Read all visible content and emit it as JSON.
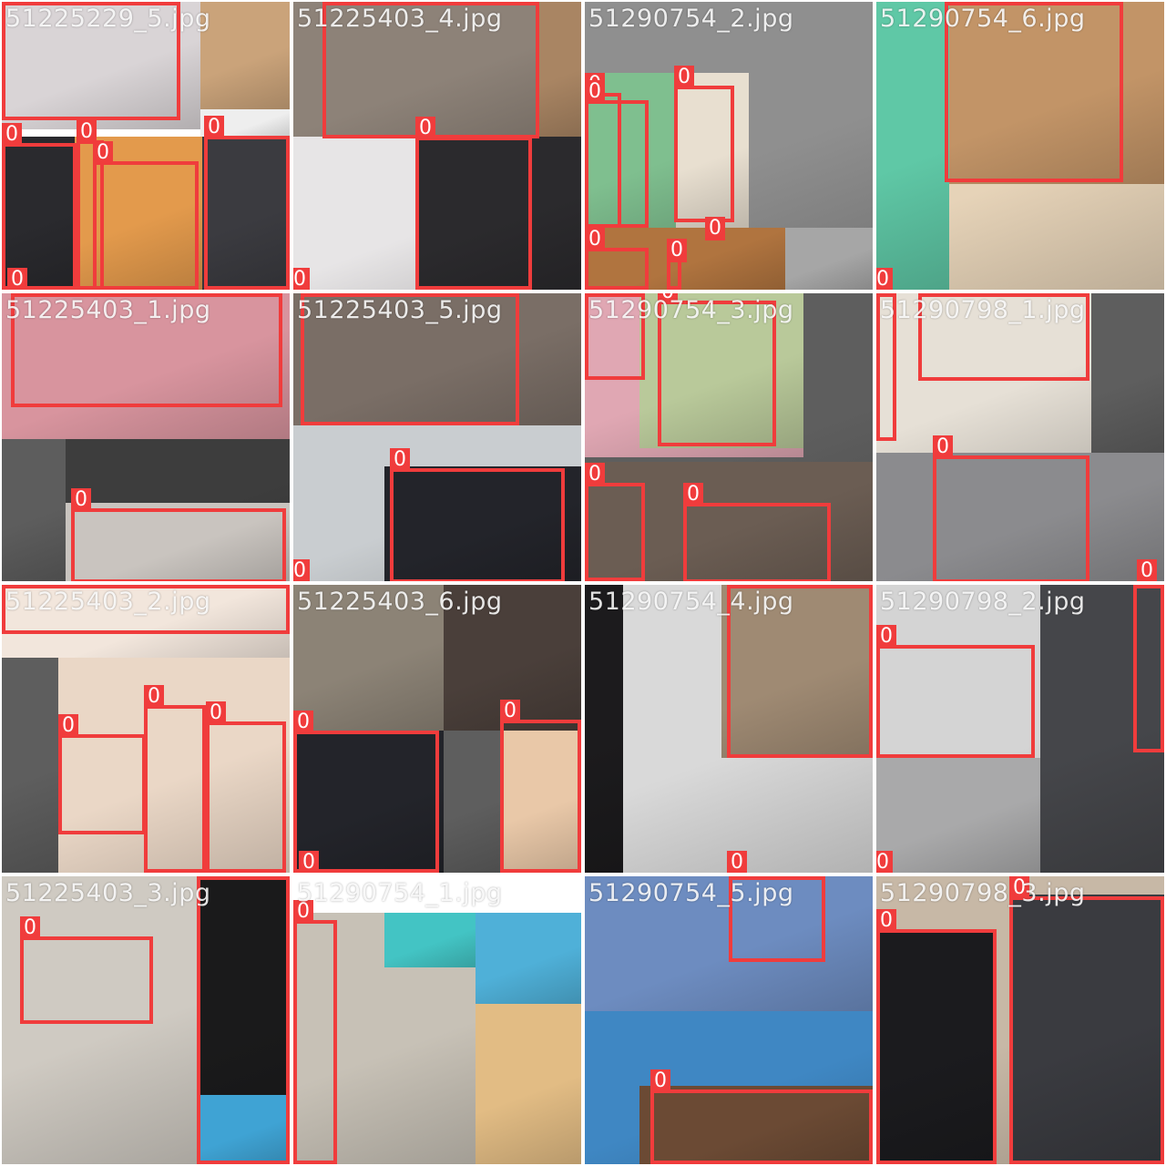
{
  "box_color": "#f03c3c",
  "tiles": [
    {
      "filename": "51225229_5.jpg",
      "photos": [
        {
          "c": "#d9d4d6"
        },
        {
          "c": "#caa37a"
        },
        {
          "c": "#eeeeee"
        },
        {
          "c": "#2a2a2e"
        },
        {
          "c": "#e39a4c"
        },
        {
          "c": "#3b3b40"
        }
      ],
      "boxes": [
        "0",
        "0",
        "0",
        "0",
        "0",
        "0"
      ]
    },
    {
      "filename": "51225403_4.jpg",
      "photos": [
        {
          "c": "#8d8278"
        },
        {
          "c": "#a98563"
        },
        {
          "c": "#e7e5e6"
        },
        {
          "c": "#2b2a2d"
        }
      ],
      "boxes": [
        "0",
        "0",
        "0"
      ]
    },
    {
      "filename": "51290754_2.jpg",
      "photos": [
        {
          "c": "#8f8f8f"
        },
        {
          "c": "#7fbf8f"
        },
        {
          "c": "#e8dfd0"
        },
        {
          "c": "#b0743f"
        },
        {
          "c": "#a6a6a6"
        }
      ],
      "boxes": [
        "0",
        "0",
        "0",
        "0",
        "0",
        "0"
      ]
    },
    {
      "filename": "51290754_6.jpg",
      "photos": [
        {
          "c": "#5fc8a6"
        },
        {
          "c": "#e6d3b8"
        },
        {
          "c": "#c29467"
        }
      ],
      "boxes": [
        "0",
        "0"
      ]
    },
    {
      "filename": "51225403_1.jpg",
      "photos": [
        {
          "c": "#d8949e"
        },
        {
          "c": "#5d5d5d"
        },
        {
          "c": "#3d3d3d"
        },
        {
          "c": "#c9c4bf"
        }
      ],
      "boxes": [
        "0",
        "0"
      ]
    },
    {
      "filename": "51225403_5.jpg",
      "photos": [
        {
          "c": "#7a6e66"
        },
        {
          "c": "#c9cdd0"
        },
        {
          "c": "#23242a"
        }
      ],
      "boxes": [
        "0",
        "0",
        "0"
      ]
    },
    {
      "filename": "51290754_3.jpg",
      "photos": [
        {
          "c": "#5e5e5e"
        },
        {
          "c": "#e0a7b3"
        },
        {
          "c": "#b9c99a"
        },
        {
          "c": "#6b5d53"
        }
      ],
      "boxes": [
        "0",
        "0",
        "0",
        "0"
      ]
    },
    {
      "filename": "51290798_1.jpg",
      "photos": [
        {
          "c": "#e6e0d6"
        },
        {
          "c": "#5e5e5e"
        },
        {
          "c": "#8b8b8e"
        }
      ],
      "boxes": [
        "0",
        "0",
        "0",
        "0"
      ]
    },
    {
      "filename": "51225403_2.jpg",
      "photos": [
        {
          "c": "#f2e6dc"
        },
        {
          "c": "#5e5e5e"
        },
        {
          "c": "#ead7c6"
        }
      ],
      "boxes": [
        "0",
        "0",
        "0",
        "0"
      ]
    },
    {
      "filename": "51225403_6.jpg",
      "photos": [
        {
          "c": "#8c8376"
        },
        {
          "c": "#4a3f3a"
        },
        {
          "c": "#23242a"
        },
        {
          "c": "#5e5e5e"
        },
        {
          "c": "#e9c8a8"
        }
      ],
      "boxes": [
        "0",
        "0",
        "0"
      ]
    },
    {
      "filename": "51290754_4.jpg",
      "photos": [
        {
          "c": "#1c1b1d"
        },
        {
          "c": "#d9d9d9"
        },
        {
          "c": "#9f8a73"
        }
      ],
      "boxes": [
        "0",
        "0"
      ]
    },
    {
      "filename": "51290798_2.jpg",
      "photos": [
        {
          "c": "#d4d4d4"
        },
        {
          "c": "#45464a"
        },
        {
          "c": "#a9a9aa"
        }
      ],
      "boxes": [
        "0",
        "0",
        "0"
      ]
    },
    {
      "filename": "51225403_3.jpg",
      "photos": [
        {
          "c": "#cfcac2"
        },
        {
          "c": "#1a1a1b"
        },
        {
          "c": "#3fa3d4"
        }
      ],
      "boxes": [
        "0",
        "0"
      ]
    },
    {
      "filename": "51290754_1.jpg",
      "photos": [
        {
          "c": "#c7c1b6"
        },
        {
          "c": "#43c4c4"
        },
        {
          "c": "#4fb0d8"
        },
        {
          "c": "#e2bc84"
        }
      ],
      "boxes": [
        "0"
      ]
    },
    {
      "filename": "51290754_5.jpg",
      "photos": [
        {
          "c": "#4d6ea8"
        },
        {
          "c": "#6d8cc0"
        },
        {
          "c": "#3f87c3"
        },
        {
          "c": "#6b4a34"
        }
      ],
      "boxes": [
        "0",
        "0"
      ]
    },
    {
      "filename": "51290798_3.jpg",
      "photos": [
        {
          "c": "#c7b8a6"
        },
        {
          "c": "#1b1b1e"
        },
        {
          "c": "#3a3b40"
        }
      ],
      "boxes": [
        "0",
        "0"
      ]
    }
  ]
}
